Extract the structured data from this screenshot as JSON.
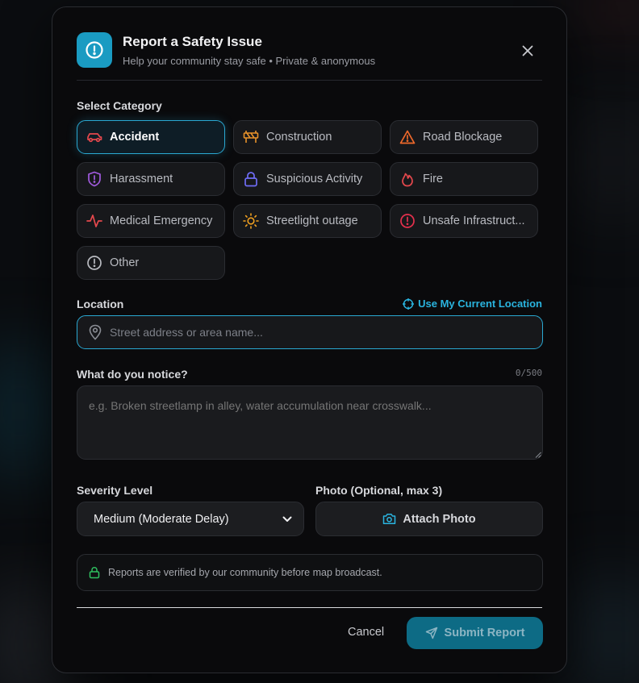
{
  "header": {
    "title": "Report a Safety Issue",
    "subtitle": "Help your community stay safe • Private & anonymous"
  },
  "category": {
    "label": "Select Category",
    "items": [
      {
        "label": "Accident",
        "icon": "car-icon",
        "color": "#e5484d",
        "active": true
      },
      {
        "label": "Construction",
        "icon": "barrier-icon",
        "color": "#e8922b"
      },
      {
        "label": "Road Blockage",
        "icon": "warning-triangle-icon",
        "color": "#f0692b"
      },
      {
        "label": "Harassment",
        "icon": "shield-alert-icon",
        "color": "#a25be0"
      },
      {
        "label": "Suspicious Activity",
        "icon": "lock-icon",
        "color": "#6f6cf5"
      },
      {
        "label": "Fire",
        "icon": "flame-icon",
        "color": "#e5484d"
      },
      {
        "label": "Medical Emergency",
        "icon": "pulse-icon",
        "color": "#e5484d"
      },
      {
        "label": "Streetlight outage",
        "icon": "sun-icon",
        "color": "#f0a020"
      },
      {
        "label": "Unsafe Infrastruct...",
        "icon": "alert-circle-icon",
        "color": "#e5304d"
      },
      {
        "label": "Other",
        "icon": "info-circle-icon",
        "color": "#b9bbc1"
      }
    ]
  },
  "location": {
    "label": "Location",
    "use_current": "Use My Current Location",
    "placeholder": "Street address or area name..."
  },
  "notice": {
    "label": "What do you notice?",
    "counter": "0/500",
    "placeholder": "e.g. Broken streetlamp in alley, water accumulation near crosswalk..."
  },
  "severity": {
    "label": "Severity Level",
    "selected": "Medium (Moderate Delay)"
  },
  "photo": {
    "label": "Photo (Optional, max 3)",
    "button": "Attach Photo"
  },
  "verify_note": "Reports are verified by our community before map broadcast.",
  "footer": {
    "cancel": "Cancel",
    "submit": "Submit Report"
  },
  "colors": {
    "accent": "#2aa8d2",
    "submit_bg": "#0d6b85",
    "lock_green": "#2fbf5f"
  }
}
